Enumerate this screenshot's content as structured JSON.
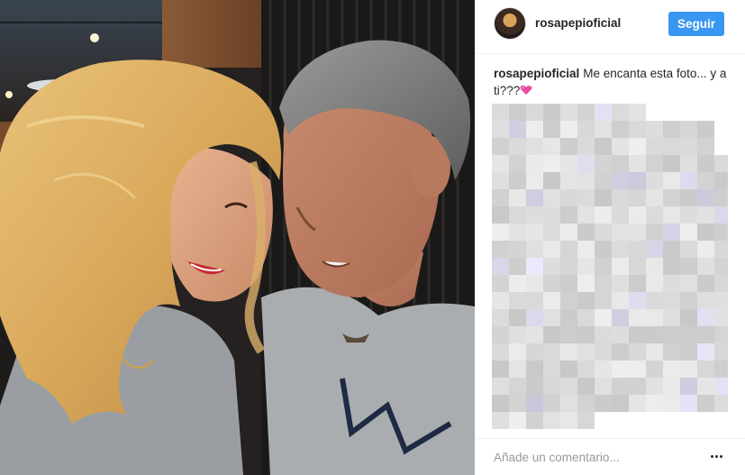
{
  "post": {
    "photo_alt": "",
    "header": {
      "username": "rosapepioficial",
      "follow_label": "Seguir"
    },
    "caption": {
      "username": "rosapepioficial",
      "text": "Me encanta esta foto... y a ti???",
      "emoji_icon": "sparkling-heart-icon"
    },
    "comments_blurred": true,
    "add_comment": {
      "placeholder": "Añade un comentario...",
      "more_icon": "ellipsis-icon"
    }
  },
  "colors": {
    "follow_button": "#3897f0",
    "text": "#262626",
    "placeholder": "#999999",
    "divider": "#efefef",
    "heart": "#e94c9d"
  }
}
